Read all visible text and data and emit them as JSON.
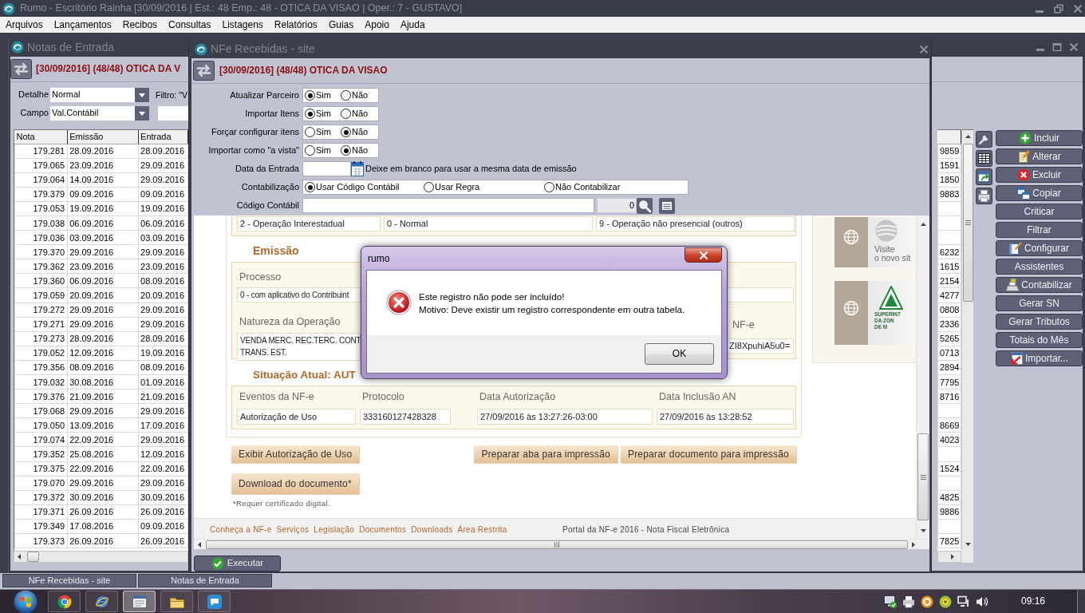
{
  "app_window": {
    "title": "Rumo - Escritório Rainha [30/09/2016 | Est.: 48 Emp.: 48 - OTICA DA VISAO | Oper.: 7 - GUSTAVO]"
  },
  "menu": [
    "Arquivos",
    "Lançamentos",
    "Recibos",
    "Consultas",
    "Listagens",
    "Relatórios",
    "Guias",
    "Apoio",
    "Ajuda"
  ],
  "notas_window": {
    "title": "Notas de Entrada",
    "header": "[30/09/2016] (48/48) OTICA DA V",
    "filters": [
      {
        "label": "Detalhe",
        "value": "Normal"
      },
      {
        "label": "Campo",
        "value": "Val.Contábil"
      }
    ],
    "filter_text": "Filtro: \"V",
    "table": {
      "columns": [
        "Nota",
        "Emissão",
        "Entrada"
      ],
      "rows": [
        {
          "cells": [
            "179.281",
            "28.09.2016",
            "28.09.2016"
          ],
          "column_4": "9859"
        },
        {
          "cells": [
            "179.065",
            "23.09.2016",
            "29.09.2016"
          ],
          "column_4": "1591"
        },
        {
          "cells": [
            "179.064",
            "14.09.2016",
            "29.09.2016"
          ],
          "column_4": "1850"
        },
        {
          "cells": [
            "179.379",
            "09.09.2016",
            "09.09.2016"
          ],
          "column_4": "9883"
        },
        {
          "cells": [
            "179.053",
            "19.09.2016",
            "19.09.2016"
          ]
        },
        {
          "cells": [
            "179.038",
            "06.09.2016",
            "06.09.2016"
          ]
        },
        {
          "cells": [
            "179.036",
            "03.09.2016",
            "03.09.2016"
          ]
        },
        {
          "cells": [
            "179.370",
            "29.09.2016",
            "29.09.2016"
          ],
          "column_4": "6232"
        },
        {
          "cells": [
            "179.362",
            "23.09.2016",
            "23.09.2016"
          ],
          "column_4": "1615"
        },
        {
          "cells": [
            "179.360",
            "06.09.2016",
            "08.09.2016"
          ],
          "column_4": "2154"
        },
        {
          "cells": [
            "179.059",
            "20.09.2016",
            "20.09.2016"
          ],
          "column_4": "4277"
        },
        {
          "cells": [
            "179.272",
            "29.09.2016",
            "29.09.2016"
          ],
          "column_4": "0808"
        },
        {
          "cells": [
            "179.271",
            "29.09.2016",
            "29.09.2016"
          ],
          "column_4": "2336"
        },
        {
          "cells": [
            "179.273",
            "28.09.2016",
            "28.09.2016"
          ],
          "column_4": "5265"
        },
        {
          "cells": [
            "179.052",
            "12.09.2016",
            "19.09.2016"
          ],
          "column_4": "0713"
        },
        {
          "cells": [
            "179.356",
            "08.09.2016",
            "08.09.2016"
          ],
          "column_4": "2894"
        },
        {
          "cells": [
            "179.032",
            "30.08.2016",
            "01.09.2016"
          ],
          "column_4": "7795"
        },
        {
          "cells": [
            "179.376",
            "21.09.2016",
            "21.09.2016"
          ],
          "column_4": "8716"
        },
        {
          "cells": [
            "179.068",
            "29.09.2016",
            "29.09.2016"
          ]
        },
        {
          "cells": [
            "179.050",
            "13.09.2016",
            "17.09.2016"
          ],
          "column_4": "8669"
        },
        {
          "cells": [
            "179.074",
            "22.09.2016",
            "29.09.2016"
          ],
          "column_4": "4023"
        },
        {
          "cells": [
            "179.352",
            "25.08.2016",
            "12.09.2016"
          ]
        },
        {
          "cells": [
            "179.375",
            "22.09.2016",
            "22.09.2016"
          ],
          "column_4": "1524"
        },
        {
          "cells": [
            "179.070",
            "29.09.2016",
            "29.09.2016"
          ]
        },
        {
          "cells": [
            "179.372",
            "30.09.2016",
            "30.09.2016"
          ],
          "column_4": "4825"
        },
        {
          "cells": [
            "179.371",
            "26.09.2016",
            "26.09.2016"
          ],
          "column_4": "9886"
        },
        {
          "cells": [
            "179.349",
            "17.08.2016",
            "09.09.2016"
          ]
        },
        {
          "cells": [
            "179.373",
            "26.09.2016",
            "26.09.2016"
          ],
          "column_4": "7825"
        }
      ]
    },
    "buttons": [
      {
        "label": "Incluir",
        "kind": "add"
      },
      {
        "label": "Alterar",
        "kind": "edit"
      },
      {
        "label": "Excluir",
        "kind": "delete"
      },
      {
        "label": "Copiar",
        "kind": "copy"
      },
      {
        "label": "Criticar",
        "kind": "plain"
      },
      {
        "label": "Filtrar",
        "kind": "plain"
      },
      {
        "label": "Configurar",
        "kind": "configure"
      },
      {
        "label": "Assistentes",
        "kind": "plain"
      },
      {
        "label": "Contabilizar",
        "kind": "register"
      },
      {
        "label": "Gerar SN",
        "kind": "plain"
      },
      {
        "label": "Gerar Tributos",
        "kind": "plain"
      },
      {
        "label": "Totais do Mês",
        "kind": "plain"
      },
      {
        "label": "Importar...",
        "kind": "import"
      }
    ]
  },
  "nfe_window": {
    "title": "NFe Recebidas - site",
    "header": "[30/09/2016] (48/48) OTICA DA VISAO",
    "radio_rows": [
      {
        "label": "Atualizar Parceiro",
        "options": [
          {
            "label": "Sim",
            "selected": true
          },
          {
            "label": "Não",
            "selected": false
          }
        ]
      },
      {
        "label": "Importar Itens",
        "options": [
          {
            "label": "Sim",
            "selected": true
          },
          {
            "label": "Não",
            "selected": false
          }
        ]
      },
      {
        "label": "Forçar configurar itens",
        "options": [
          {
            "label": "Sim",
            "selected": false
          },
          {
            "label": "Não",
            "selected": true
          }
        ]
      },
      {
        "label": "Importar como \"a vista\"",
        "options": [
          {
            "label": "Sim",
            "selected": false
          },
          {
            "label": "Não",
            "selected": true
          }
        ]
      }
    ],
    "entry_date": {
      "label": "Data da Entrada",
      "hint": "Deixe em branco para usar a mesma data de emissão"
    },
    "accounting": {
      "label": "Contabilização",
      "options": [
        {
          "label": "Usar Código Contábil",
          "selected": true
        },
        {
          "label": "Usar Regra",
          "selected": false
        },
        {
          "label": "Não Contabilizar",
          "selected": false
        }
      ]
    },
    "account_code": {
      "label": "Código Contábil",
      "value": "0"
    },
    "web_page": {
      "top_fields": [
        "2 - Operação Interestadual",
        "0 - Normal",
        "9 - Operação não presencial (outros)"
      ],
      "emission": {
        "heading": "Emissão",
        "process_label": "Processo",
        "process_value": "0 - com aplicativo do Contribuint",
        "nature_label": "Natureza da Operação",
        "nature_lines": [
          "VENDA MERC. REC.TERC. CONT",
          "TRANS. EST."
        ],
        "digest_label": "NF-e",
        "digest_value": "ZI8XpuhiA5u0="
      },
      "status": {
        "heading": "Situação Atual: AUT",
        "columns": [
          {
            "label": "Eventos da NF-e",
            "value": "Autorização de Uso"
          },
          {
            "label": "Protocolo",
            "value": "333160127428328"
          },
          {
            "label": "Data Autorização",
            "value": "27/09/2016 às 13:27:26-03:00"
          },
          {
            "label": "Data Inclusão AN",
            "value": "27/09/2016 às 13:28:52"
          }
        ]
      },
      "buttons": [
        "Exibir Autorização de Uso",
        "Preparar aba para impressão",
        "Preparar documento para impressão"
      ],
      "download_button": "Download do documento*",
      "note": "*Requer certificado digital.",
      "footer_links": [
        "Conheça a NF-e",
        "Serviços",
        "Legislação",
        "Documentos",
        "Downloads",
        "Área Restrita"
      ],
      "footer_text": "Portal da NF-e 2016 - Nota Fiscal Eletrônica",
      "banners": [
        {
          "kind": "site",
          "lines": [
            "Visite",
            "o novo sít"
          ]
        },
        {
          "kind": "logo",
          "lines": [
            "SUPERINT",
            "DA ZON",
            "DE M"
          ]
        }
      ]
    },
    "execute_button": "Executar"
  },
  "dialog": {
    "title": "rumo",
    "message_lines": [
      "Este registro não pode ser incluído!",
      "Motivo: Deve existir um registro correspondente em outra tabela."
    ],
    "button": "OK"
  },
  "window_tabs": [
    "NFe Recebidas - site",
    "Notas de Entrada"
  ],
  "taskbar": {
    "apps": [
      {
        "kind": "segmented",
        "selected": false
      },
      {
        "kind": "orbit",
        "selected": false
      },
      {
        "kind": "window",
        "selected": true
      },
      {
        "kind": "folder",
        "selected": false
      },
      {
        "kind": "chat",
        "selected": false
      }
    ],
    "clock": "09:16"
  }
}
